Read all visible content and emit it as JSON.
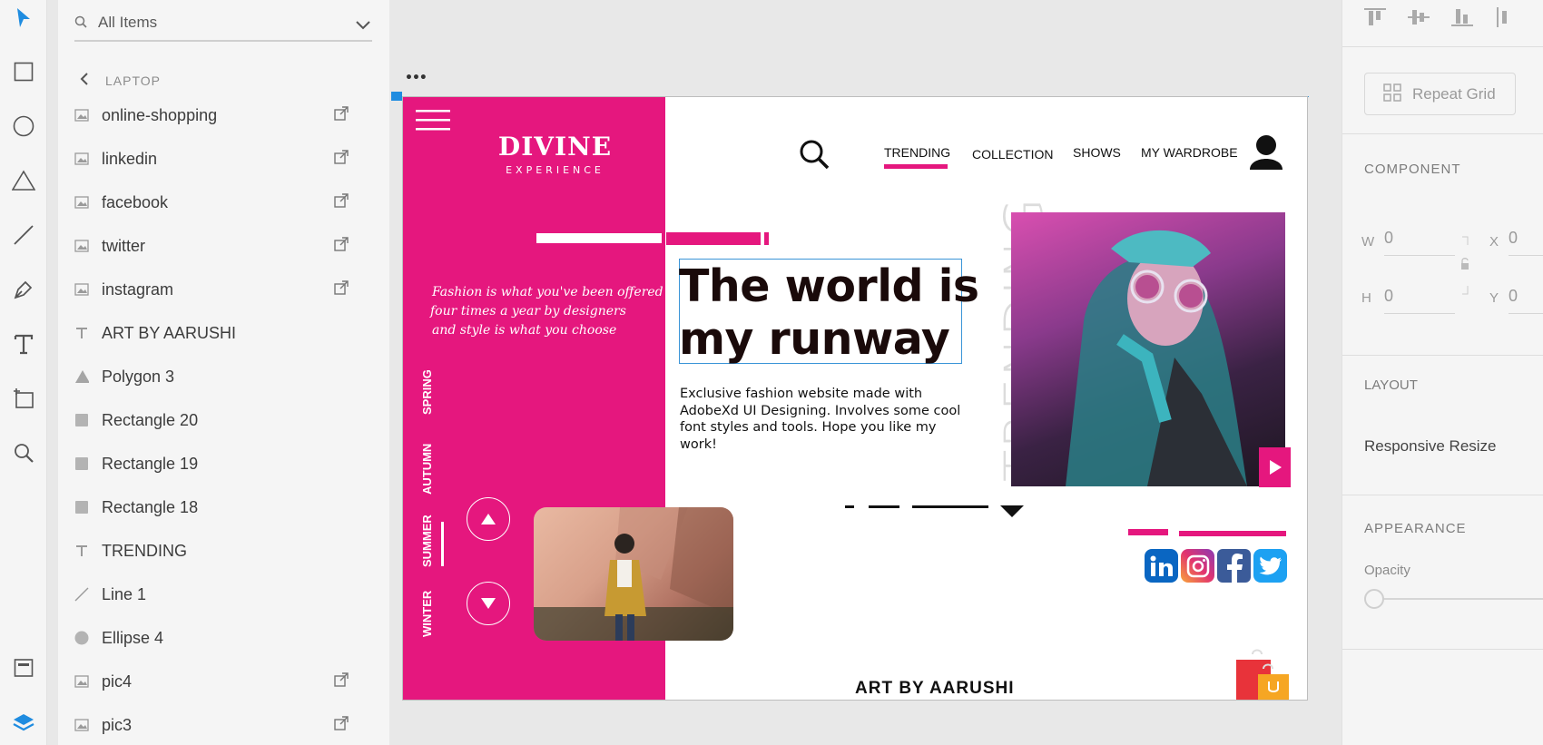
{
  "layers_panel": {
    "search_value": "All Items",
    "breadcrumb": "LAPTOP",
    "items": [
      {
        "label": "online-shopping",
        "icon": "image-icon",
        "link": true
      },
      {
        "label": "linkedin",
        "icon": "image-icon",
        "link": true
      },
      {
        "label": "facebook",
        "icon": "image-icon",
        "link": true
      },
      {
        "label": "twitter",
        "icon": "image-icon",
        "link": true
      },
      {
        "label": "instagram",
        "icon": "image-icon",
        "link": true
      },
      {
        "label": "ART BY AARUSHI",
        "icon": "text-icon",
        "link": false
      },
      {
        "label": "Polygon 3",
        "icon": "polygon-icon",
        "link": false
      },
      {
        "label": "Rectangle 20",
        "icon": "rectangle-icon",
        "link": false
      },
      {
        "label": "Rectangle 19",
        "icon": "rectangle-icon",
        "link": false
      },
      {
        "label": "Rectangle 18",
        "icon": "rectangle-icon",
        "link": false
      },
      {
        "label": "TRENDING",
        "icon": "text-icon",
        "link": false
      },
      {
        "label": "Line 1",
        "icon": "line-icon",
        "link": false
      },
      {
        "label": "Ellipse 4",
        "icon": "ellipse-icon",
        "link": false
      },
      {
        "label": "pic4",
        "icon": "image-icon",
        "link": true
      },
      {
        "label": "pic3",
        "icon": "image-icon",
        "link": true
      }
    ]
  },
  "artboard": {
    "brand_title": "DIVINE",
    "brand_subtitle": "EXPERIENCE",
    "quote_lines": [
      "Fashion is what you've been offered",
      "four times a year by designers",
      "and style is what you choose"
    ],
    "seasons": [
      "SPRING",
      "AUTUMN",
      "SUMMER",
      "WINTER"
    ],
    "nav": [
      "TRENDING",
      "COLLECTION",
      "SHOWS",
      "MY WARDROBE"
    ],
    "headline_lines": [
      "The world is",
      "my runway"
    ],
    "description": "Exclusive fashion website made with AdobeXd UI Designing. Involves some cool font styles and tools. Hope you like my work!",
    "vertical_text": "TRENDING",
    "footer_text": "ART BY AARUSHI",
    "social": [
      "linkedin-icon",
      "instagram-icon",
      "facebook-icon",
      "twitter-icon"
    ]
  },
  "right_panel": {
    "repeat_grid": "Repeat Grid",
    "component_label": "COMPONENT",
    "w_label": "W",
    "w_value": "0",
    "h_label": "H",
    "h_value": "0",
    "x_label": "X",
    "x_value": "0",
    "y_label": "Y",
    "y_value": "0",
    "layout_label": "LAYOUT",
    "responsive_resize": "Responsive Resize",
    "appearance_label": "APPEARANCE",
    "opacity_label": "Opacity"
  },
  "colors": {
    "accent_blue": "#1f8ce0",
    "brand_pink": "#e5177e"
  }
}
